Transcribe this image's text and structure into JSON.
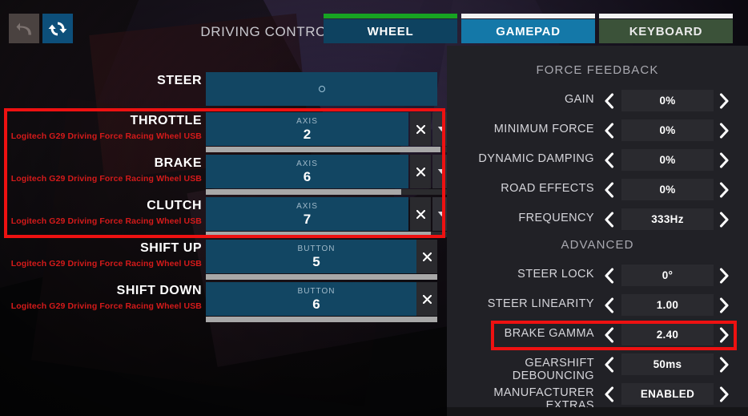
{
  "header": {
    "undo_icon": "undo-icon",
    "reset_icon": "refresh-icon",
    "title": "DRIVING CONTROL",
    "tabs": [
      {
        "label": "WHEEL",
        "marker_color": "#17a322",
        "active": false
      },
      {
        "label": "GAMEPAD",
        "marker_color": "#f2f2f2",
        "active": true
      },
      {
        "label": "KEYBOARD",
        "marker_color": "#f2f2f2",
        "active": false
      }
    ]
  },
  "bindings": {
    "device_name": "Logitech G29 Driving Force Racing Wheel USB",
    "clear_icon": "close-icon",
    "dropdown_icon": "chevron-down-icon",
    "rows": [
      {
        "label": "STEER",
        "kind": "",
        "value": "",
        "device": "",
        "fill": 0,
        "type": "steer"
      },
      {
        "label": "THROTTLE",
        "kind": "AXIS",
        "value": "2",
        "device": "Logitech G29 Driving Force Racing Wheel USB",
        "fill": 96,
        "type": "axis"
      },
      {
        "label": "BRAKE",
        "kind": "AXIS",
        "value": "6",
        "device": "Logitech G29 Driving Force Racing Wheel USB",
        "fill": 80,
        "type": "axis"
      },
      {
        "label": "CLUTCH",
        "kind": "AXIS",
        "value": "7",
        "device": "Logitech G29 Driving Force Racing Wheel USB",
        "fill": 92,
        "type": "axis"
      },
      {
        "label": "SHIFT UP",
        "kind": "BUTTON",
        "value": "5",
        "device": "Logitech G29 Driving Force Racing Wheel USB",
        "fill": 100,
        "type": "button"
      },
      {
        "label": "SHIFT DOWN",
        "kind": "BUTTON",
        "value": "6",
        "device": "Logitech G29 Driving Force Racing Wheel USB",
        "fill": 100,
        "type": "button"
      }
    ]
  },
  "settings": {
    "prev_icon": "chevron-left-icon",
    "next_icon": "chevron-right-icon",
    "force_feedback": {
      "title": "FORCE FEEDBACK",
      "options": [
        {
          "label": "GAIN",
          "value": "0%"
        },
        {
          "label": "MINIMUM FORCE",
          "value": "0%"
        },
        {
          "label": "DYNAMIC DAMPING",
          "value": "0%"
        },
        {
          "label": "ROAD EFFECTS",
          "value": "0%"
        },
        {
          "label": "FREQUENCY",
          "value": "333Hz"
        }
      ]
    },
    "advanced": {
      "title": "ADVANCED",
      "options": [
        {
          "label": "STEER LOCK",
          "value": "0°"
        },
        {
          "label": "STEER LINEARITY",
          "value": "1.00"
        },
        {
          "label": "BRAKE GAMMA",
          "value": "2.40"
        },
        {
          "label": "GEARSHIFT DEBOUNCING",
          "value": "50ms"
        },
        {
          "label": "MANUFACTURER EXTRAS",
          "value": "ENABLED"
        }
      ]
    }
  },
  "annotations": {
    "color": "#ee1111",
    "boxes": [
      {
        "name": "pedal-bindings-highlight"
      },
      {
        "name": "brake-gamma-highlight"
      }
    ]
  }
}
